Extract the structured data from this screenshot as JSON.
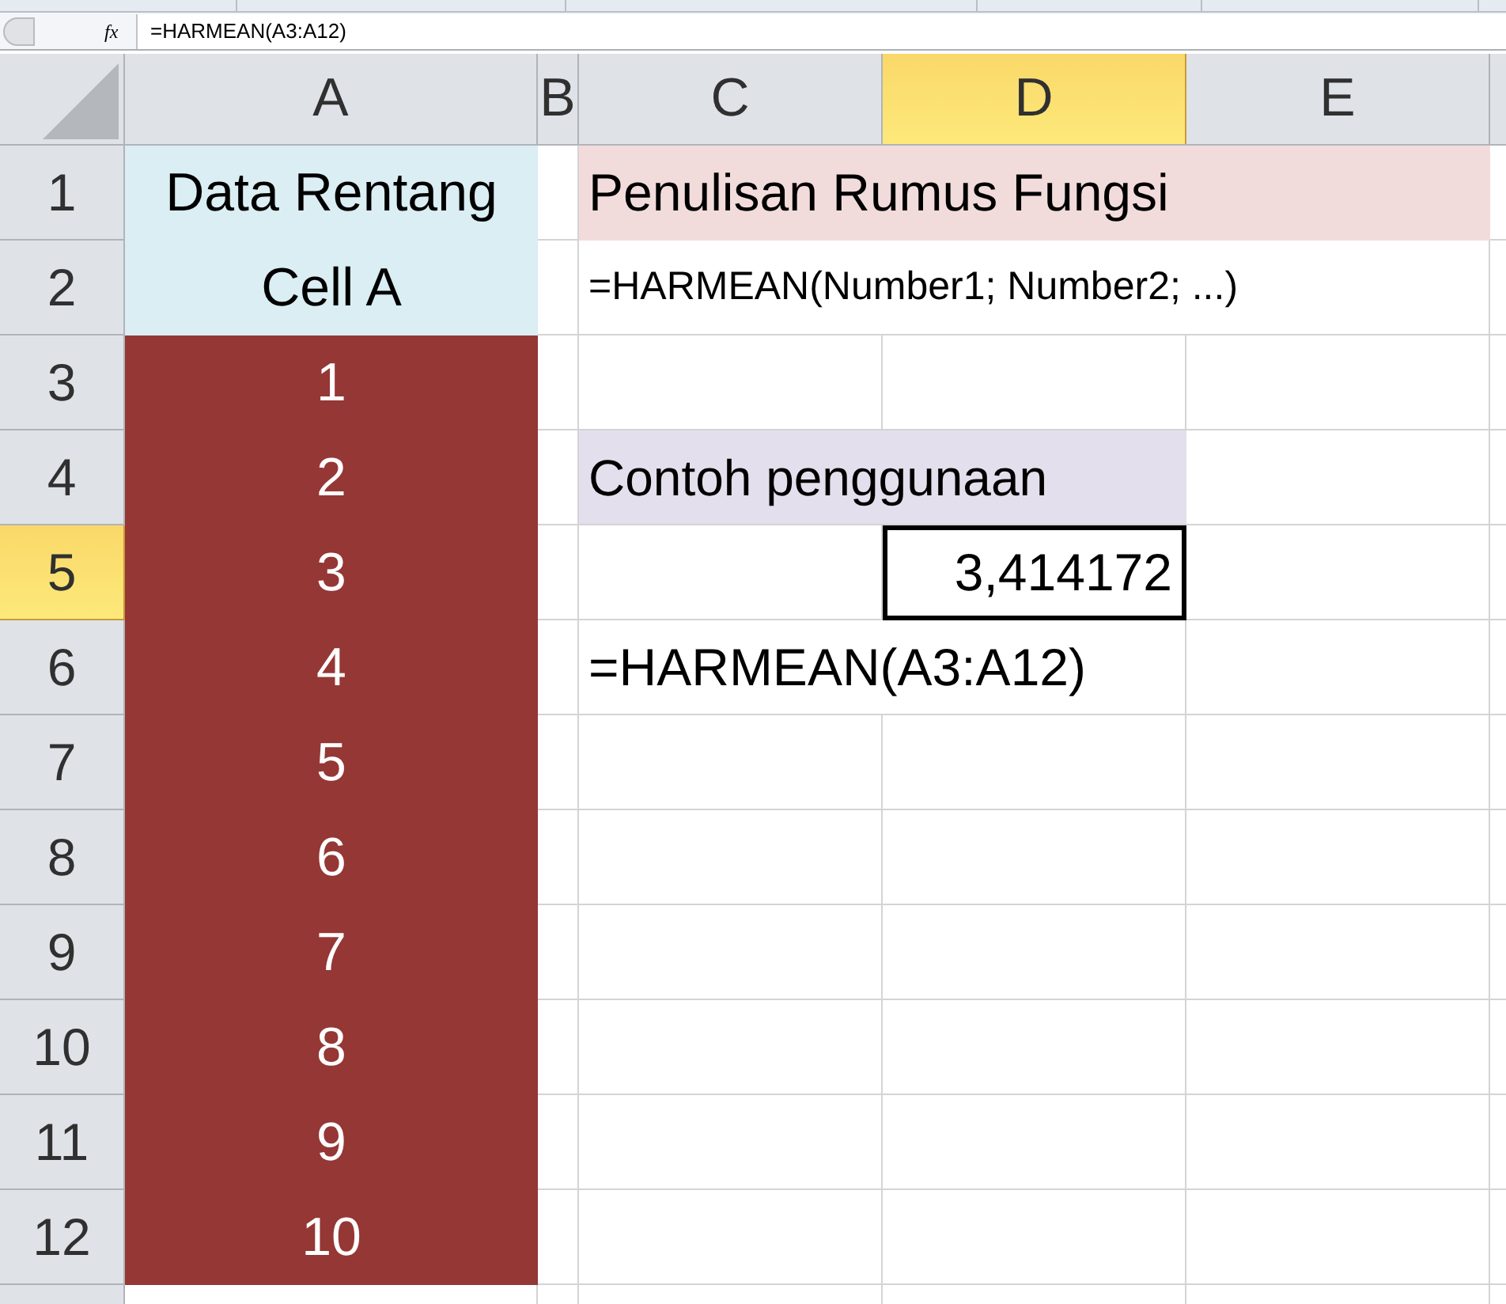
{
  "formula_bar": {
    "fx": "fx",
    "formula": "=HARMEAN(A3:A12)"
  },
  "columns": [
    {
      "label": "A",
      "selected": false
    },
    {
      "label": "B",
      "selected": false
    },
    {
      "label": "C",
      "selected": false
    },
    {
      "label": "D",
      "selected": true
    },
    {
      "label": "E",
      "selected": false
    }
  ],
  "rows": [
    {
      "label": "1",
      "selected": false,
      "cell_a": {
        "text": "Data Rentang",
        "kind": "header"
      },
      "content": {
        "text": "Penulisan Rumus Fungsi",
        "kind": "title"
      }
    },
    {
      "label": "2",
      "selected": false,
      "cell_a": {
        "text": "Cell A",
        "kind": "header"
      },
      "content": {
        "text": "=HARMEAN(Number1; Number2; ...)",
        "kind": "syntax"
      }
    },
    {
      "label": "3",
      "selected": false,
      "cell_a": {
        "text": "1",
        "kind": "value"
      }
    },
    {
      "label": "4",
      "selected": false,
      "cell_a": {
        "text": "2",
        "kind": "value"
      },
      "content": {
        "text": "Contoh penggunaan",
        "kind": "heading"
      }
    },
    {
      "label": "5",
      "selected": true,
      "cell_a": {
        "text": "3",
        "kind": "value"
      },
      "content": {
        "text": "3,414172",
        "kind": "result",
        "selected": true
      }
    },
    {
      "label": "6",
      "selected": false,
      "cell_a": {
        "text": "4",
        "kind": "value"
      },
      "content": {
        "text": "=HARMEAN(A3:A12)",
        "kind": "formula"
      }
    },
    {
      "label": "7",
      "selected": false,
      "cell_a": {
        "text": "5",
        "kind": "value"
      }
    },
    {
      "label": "8",
      "selected": false,
      "cell_a": {
        "text": "6",
        "kind": "value"
      }
    },
    {
      "label": "9",
      "selected": false,
      "cell_a": {
        "text": "7",
        "kind": "value"
      }
    },
    {
      "label": "10",
      "selected": false,
      "cell_a": {
        "text": "8",
        "kind": "value"
      }
    },
    {
      "label": "11",
      "selected": false,
      "cell_a": {
        "text": "9",
        "kind": "value"
      }
    },
    {
      "label": "12",
      "selected": false,
      "cell_a": {
        "text": "10",
        "kind": "value"
      }
    }
  ]
}
